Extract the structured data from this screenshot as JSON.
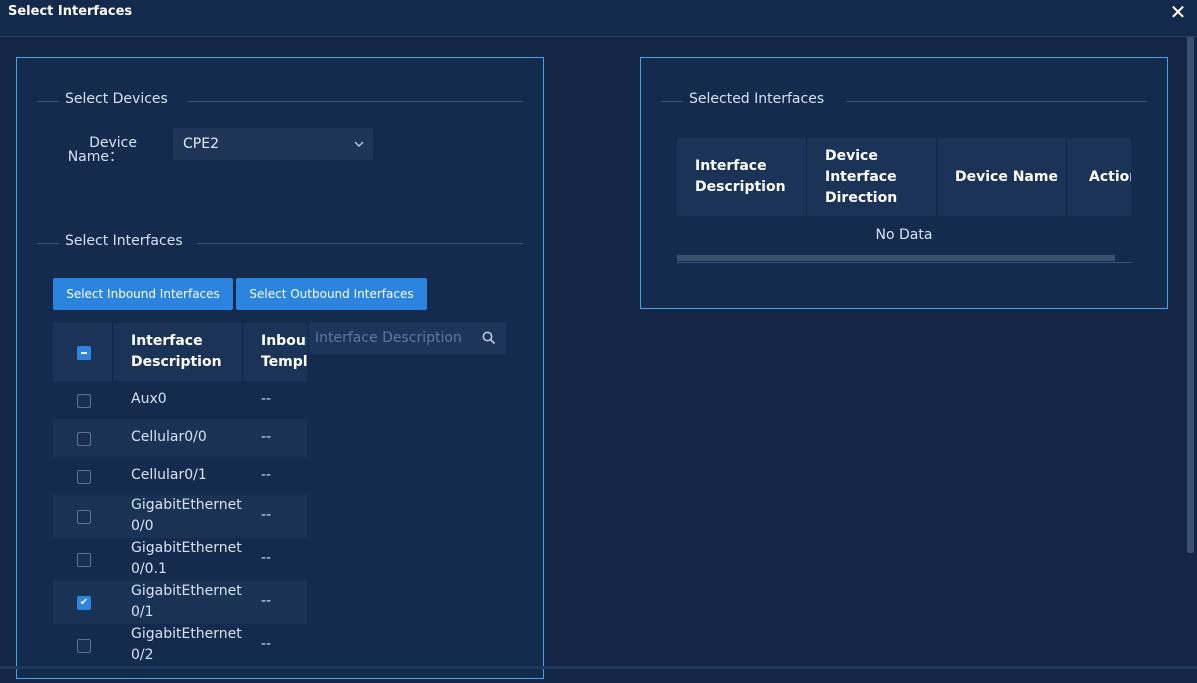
{
  "dialog": {
    "title": "Select Interfaces",
    "close_icon": "close-icon"
  },
  "left": {
    "devices_legend": "Select Devices",
    "device_name_label": "Device\nName：",
    "device_name_value": "CPE2",
    "interfaces_legend": "Select Interfaces",
    "inbound_button": "Select Inbound Interfaces",
    "outbound_button": "Select Outbound Interfaces",
    "search_placeholder": "Interface Description",
    "search_icon": "search-icon",
    "table": {
      "headers": [
        "Interface\nDescription",
        "Inbound\nTemplate"
      ],
      "select_all_state": "indeterminate",
      "rows": [
        {
          "description": "Aux0",
          "inbound": "--",
          "checked": false
        },
        {
          "description": "Cellular0/0",
          "inbound": "--",
          "checked": false
        },
        {
          "description": "Cellular0/1",
          "inbound": "--",
          "checked": false
        },
        {
          "description": "GigabitEthernet\n0/0",
          "inbound": "--",
          "checked": false
        },
        {
          "description": "GigabitEthernet\n0/0.1",
          "inbound": "--",
          "checked": false
        },
        {
          "description": "GigabitEthernet\n0/1",
          "inbound": "--",
          "checked": true
        },
        {
          "description": "GigabitEthernet\n0/2",
          "inbound": "--",
          "checked": false
        }
      ]
    }
  },
  "right": {
    "selected_legend": "Selected Interfaces",
    "headers": [
      "Interface\nDescription",
      "Device\nInterface\nDirection",
      "Device Name",
      "Action"
    ],
    "empty_text": "No Data"
  },
  "colors": {
    "background": "#132646",
    "panel_border": "#3ea8e0",
    "button": "#2b85df",
    "header_row": "#1b3356"
  }
}
